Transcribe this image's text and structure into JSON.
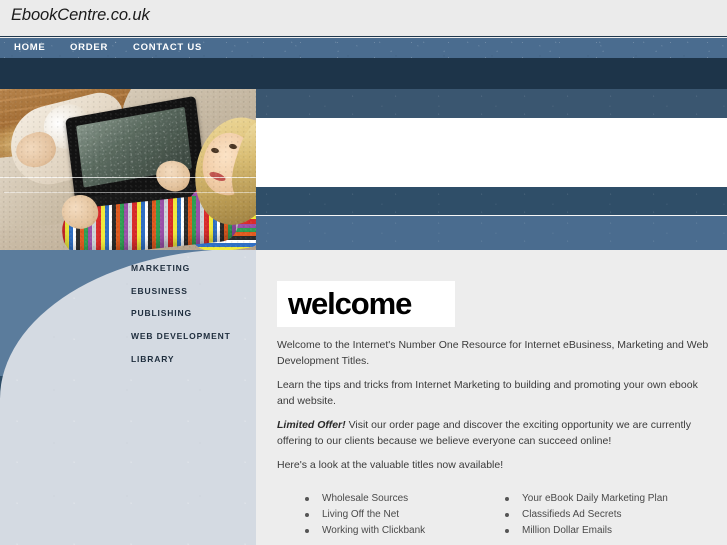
{
  "header": {
    "logo": "EbookCentre.co.uk"
  },
  "nav": {
    "items": [
      {
        "label": "HOME"
      },
      {
        "label": "ORDER"
      },
      {
        "label": "CONTACT US"
      }
    ]
  },
  "hero": {
    "image_alt": "woman reclining on cream sofa using a black laptop, wearing a multicolored striped sweater"
  },
  "sidebar": {
    "items": [
      {
        "label": "MARKETING"
      },
      {
        "label": "EBUSINESS"
      },
      {
        "label": "PUBLISHING"
      },
      {
        "label": "WEB DEVELOPMENT"
      },
      {
        "label": "LIBRARY"
      }
    ]
  },
  "main": {
    "heading": "welcome",
    "paragraphs": [
      "Welcome to the Internet's Number One Resource for Internet eBusiness, Marketing and Web Development Titles.",
      "Learn the tips and tricks from Internet Marketing to building and promoting your own ebook and website.",
      "Visit our order page and discover the exciting opportunity we are currently offering to our clients because we believe everyone can succeed online!",
      "Here's a look at the valuable titles now available!"
    ],
    "offer_label": "Limited Offer!",
    "titles_left": [
      {
        "label": "Wholesale Sources"
      },
      {
        "label": "Living Off the Net"
      },
      {
        "label": "Working with Clickbank"
      }
    ],
    "titles_right": [
      {
        "label": "Your eBook Daily Marketing Plan"
      },
      {
        "label": "Classifieds Ad Secrets"
      },
      {
        "label": "Million Dollar Emails"
      }
    ]
  },
  "colors": {
    "nav_bar": "#4a6c8f",
    "navy_strip": "#1d3449",
    "band_dark": "#3a5670",
    "band_mid": "#2f4e68",
    "band_light": "#4a6c8f",
    "sidebar_panel": "#d4dae2",
    "content_bg": "#ededed",
    "header_bg": "#ebebeb",
    "heading_text": "#000000",
    "body_text": "#3b3b3b"
  }
}
